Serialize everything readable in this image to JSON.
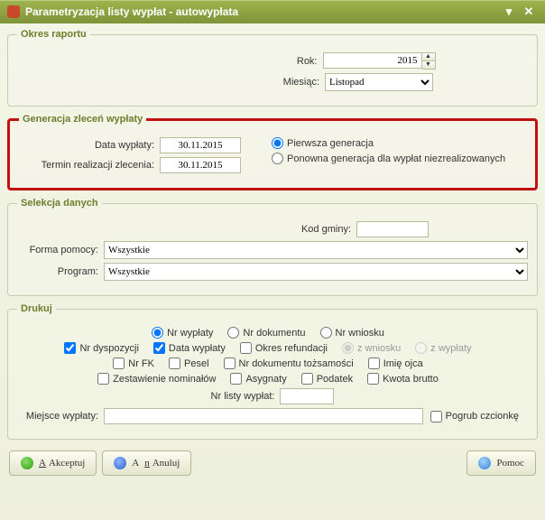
{
  "window": {
    "title": "Parametryzacja listy wypłat - autowypłata"
  },
  "okres": {
    "legend": "Okres raportu",
    "rok_label": "Rok:",
    "rok_value": "2015",
    "miesiac_label": "Miesiąc:",
    "miesiac_value": "Listopad"
  },
  "gen": {
    "legend": "Generacja zleceń wypłaty",
    "data_label": "Data wypłaty:",
    "data_value": "30.11.2015",
    "termin_label": "Termin realizacji zlecenia:",
    "termin_value": "30.11.2015",
    "r1": "Pierwsza generacja",
    "r2": "Ponowna generacja dla wypłat niezrealizowanych"
  },
  "sel": {
    "legend": "Selekcja danych",
    "kod_label": "Kod gminy:",
    "kod_value": "",
    "forma_label": "Forma pomocy:",
    "forma_value": "Wszystkie",
    "program_label": "Program:",
    "program_value": "Wszystkie"
  },
  "druk": {
    "legend": "Drukuj",
    "r_nr_wyplaty": "Nr wypłaty",
    "r_nr_dokumentu": "Nr dokumentu",
    "r_nr_wniosku": "Nr wniosku",
    "c_nr_dyspozycji": "Nr dyspozycji",
    "c_data_wyplaty": "Data wypłaty",
    "c_okres_refundacji": "Okres refundacji",
    "r_z_wniosku": "z wniosku",
    "r_z_wyplaty": "z wypłaty",
    "c_nr_fk": "Nr FK",
    "c_pesel": "Pesel",
    "c_nr_dok_toz": "Nr dokumentu tożsamości",
    "c_imie_ojca": "Imię ojca",
    "c_zest_nom": "Zestawienie nominałów",
    "c_asygnaty": "Asygnaty",
    "c_podatek": "Podatek",
    "c_kwota_brutto": "Kwota brutto",
    "nr_listy_label": "Nr listy wypłat:",
    "nr_listy_value": "",
    "miejsce_label": "Miejsce wypłaty:",
    "miejsce_value": "",
    "pogrub": "Pogrub czcionkę"
  },
  "buttons": {
    "ok": "Akceptuj",
    "cancel": "Anuluj",
    "help": "Pomoc"
  }
}
